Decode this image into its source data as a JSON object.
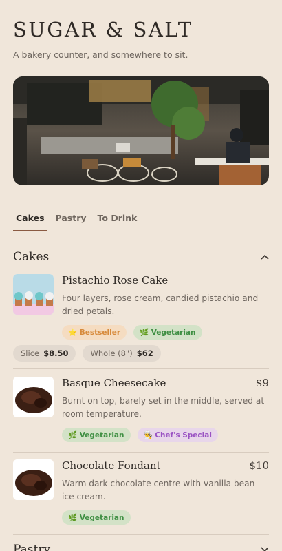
{
  "brand": "SUGAR & SALT",
  "tagline": "A bakery counter, and somewhere to sit.",
  "tabs": [
    {
      "label": "Cakes",
      "active": true
    },
    {
      "label": "Pastry",
      "active": false
    },
    {
      "label": "To Drink",
      "active": false
    }
  ],
  "sections": {
    "cakes": {
      "title": "Cakes",
      "chevron": "chevron-up-icon"
    },
    "pastry": {
      "title": "Pastry",
      "chevron": "chevron-down-icon"
    }
  },
  "items": [
    {
      "name": "Pistachio Rose Cake",
      "price": "",
      "description": "Four layers, rose cream, candied pistachio and dried petals.",
      "tags": [
        {
          "icon": "star-icon",
          "label": "Bestseller"
        },
        {
          "icon": "leaf-icon",
          "label": "Vegetarian"
        }
      ],
      "sizes": [
        {
          "label": "Slice",
          "price": "$8.50"
        },
        {
          "label": "Whole (8\")",
          "price": "$62"
        }
      ]
    },
    {
      "name": "Basque Cheesecake",
      "price": "$9",
      "description": "Burnt on top, barely set in the middle, served at room temperature.",
      "tags": [
        {
          "icon": "leaf-icon",
          "label": "Vegetarian"
        },
        {
          "icon": "chef-hat-icon",
          "label": "Chef's Special"
        }
      ]
    },
    {
      "name": "Chocolate Fondant",
      "price": "$10",
      "description": "Warm dark chocolate centre with vanilla bean ice cream.",
      "tags": [
        {
          "icon": "leaf-icon",
          "label": "Vegetarian"
        }
      ]
    }
  ],
  "colors": {
    "background": "#f0e6da",
    "accent": "#8a5a42",
    "bestseller": "#d78a3b",
    "vegetarian": "#3f8f43",
    "chef_special": "#9a52c3"
  }
}
